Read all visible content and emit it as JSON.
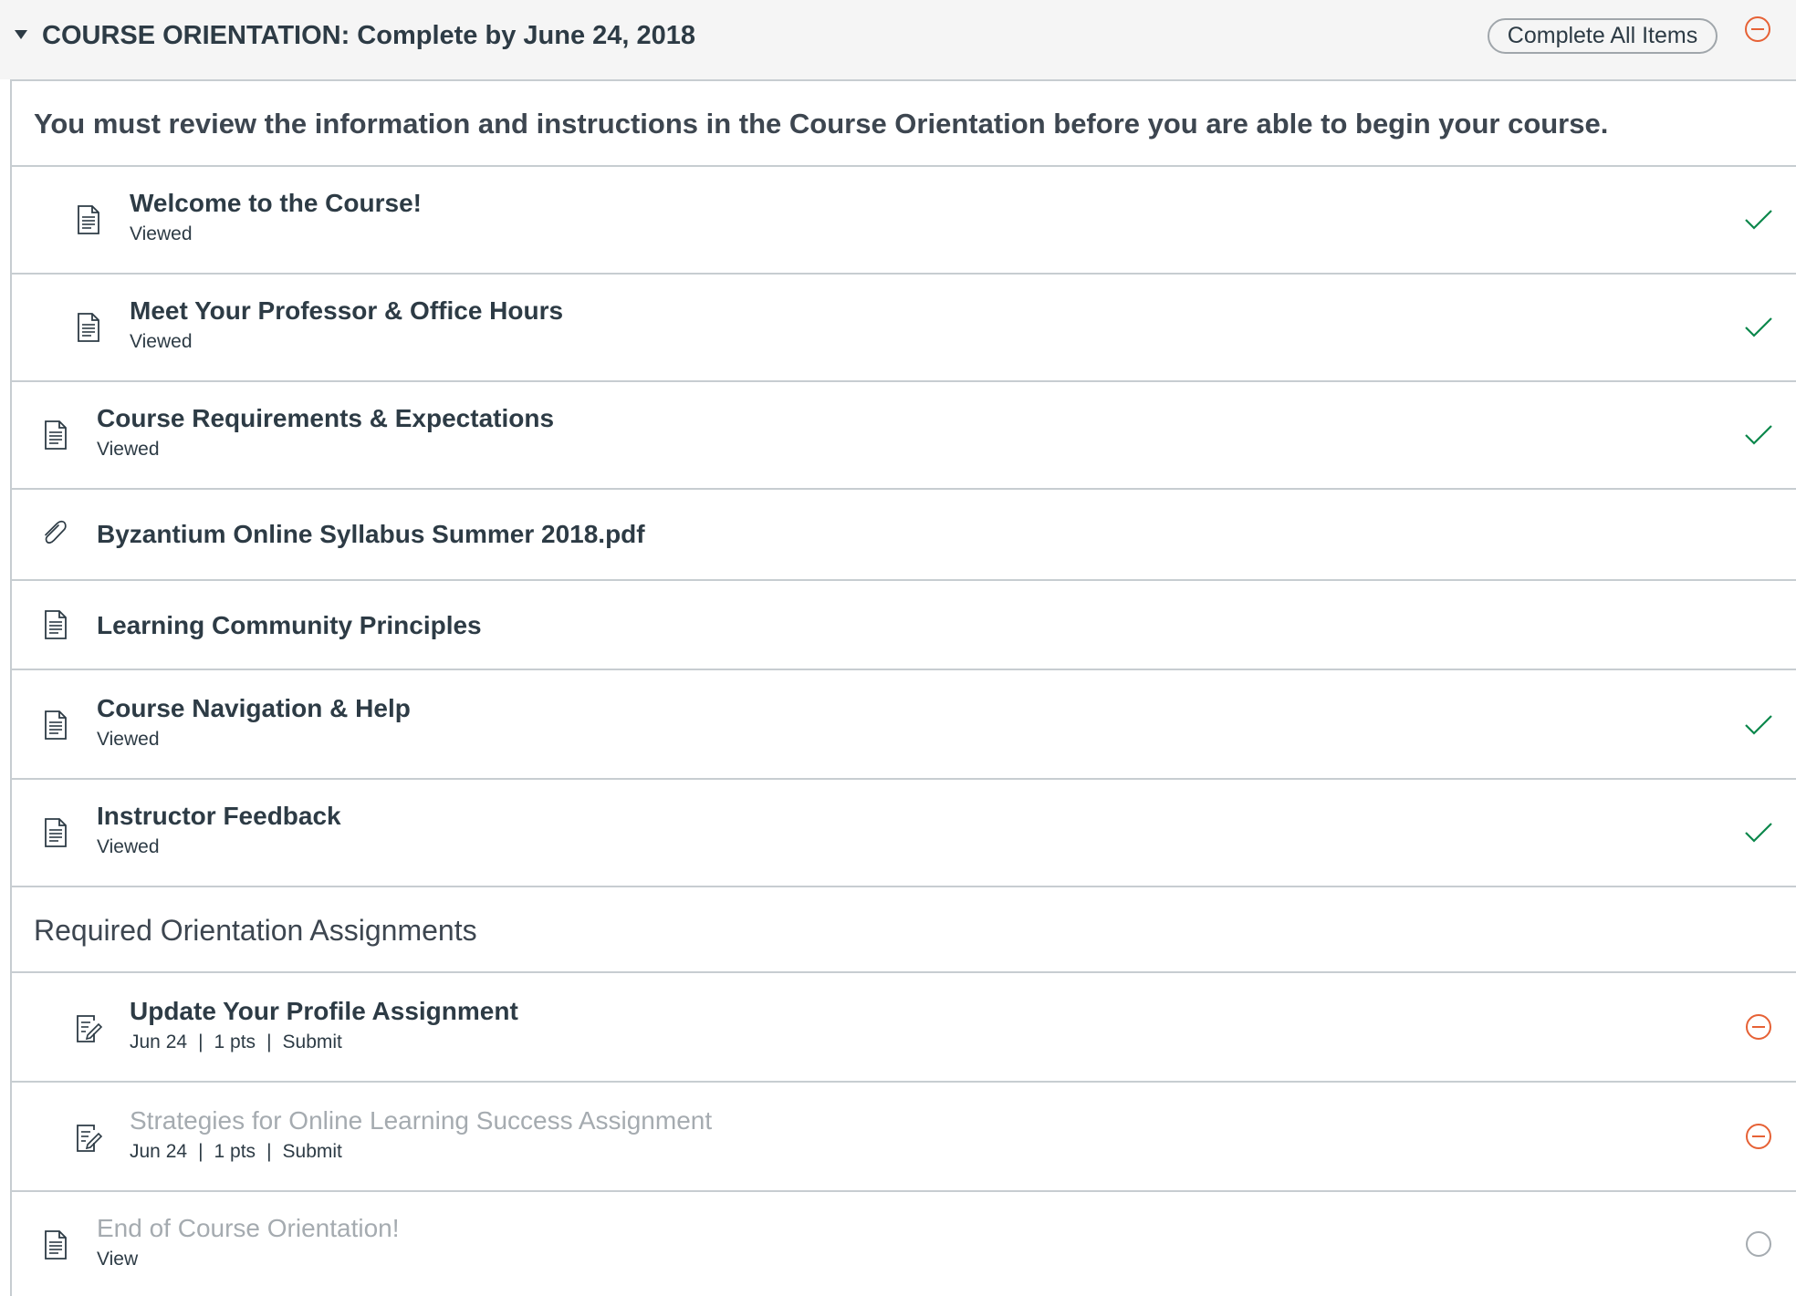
{
  "module": {
    "title": "COURSE ORIENTATION: Complete by June 24, 2018",
    "complete_all_label": "Complete All Items"
  },
  "intro": "You must review the information and instructions in the Course Orientation before you are able to begin your course.",
  "items": [
    {
      "title": "Welcome to the Course!",
      "sub": "Viewed",
      "icon": "page-icon",
      "status": "check-icon"
    },
    {
      "title": "Meet Your Professor & Office Hours",
      "sub": "Viewed",
      "icon": "page-icon",
      "status": "check-icon"
    },
    {
      "title": "Course Requirements & Expectations",
      "sub": "Viewed",
      "icon": "page-icon",
      "status": "check-icon"
    },
    {
      "title": "Byzantium Online Syllabus Summer 2018.pdf",
      "icon": "paperclip-icon"
    },
    {
      "title": "Learning Community Principles",
      "icon": "page-icon"
    },
    {
      "title": "Course Navigation & Help",
      "sub": "Viewed",
      "icon": "page-icon",
      "status": "check-icon"
    },
    {
      "title": "Instructor Feedback",
      "sub": "Viewed",
      "icon": "page-icon",
      "status": "check-icon"
    }
  ],
  "section": {
    "title": "Required Orientation Assignments"
  },
  "assignments": [
    {
      "title": "Update Your Profile Assignment",
      "due": "Jun 24",
      "points": "1 pts",
      "action": "Submit",
      "separator": "|",
      "icon": "assignment-icon",
      "status": "minus-circle-icon"
    },
    {
      "title": "Strategies for Online Learning Success Assignment",
      "due": "Jun 24",
      "points": "1 pts",
      "action": "Submit",
      "separator": "|",
      "icon": "assignment-icon",
      "status": "minus-circle-icon"
    }
  ],
  "final_item": {
    "title": "End of Course Orientation!",
    "sub": "View",
    "icon": "page-icon",
    "status": "empty-circle-icon"
  },
  "colors": {
    "complete": "#0b874b",
    "incomplete": "#e66135",
    "empty": "#a5abb0",
    "text": "#2d3b45",
    "muted": "#a5abb0",
    "border": "#c7cdd1"
  }
}
